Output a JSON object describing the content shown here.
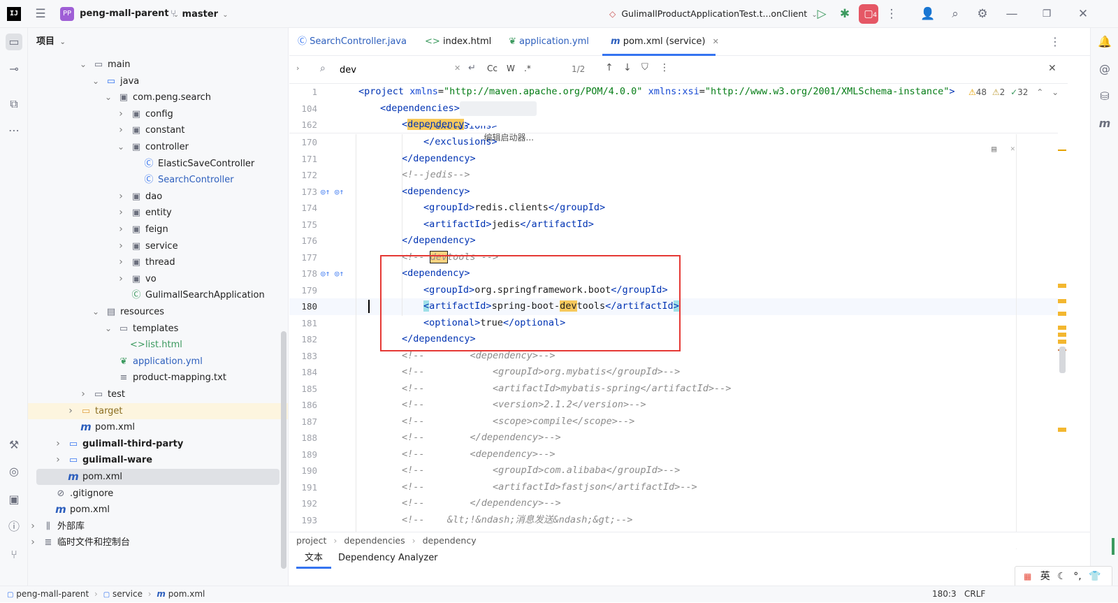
{
  "topbar": {
    "project_badge": "PP",
    "project_name": "peng-mall-parent",
    "branch": "master",
    "run_config": "GulimallProductApplicationTest.t...onClient",
    "notification_count": "4"
  },
  "project_panel": {
    "title": "项目",
    "tree": [
      {
        "label": "main",
        "depth": 0,
        "arrow": "v",
        "icon": "folder"
      },
      {
        "label": "java",
        "depth": 1,
        "arrow": "v",
        "icon": "folder-src"
      },
      {
        "label": "com.peng.search",
        "depth": 2,
        "arrow": "v",
        "icon": "package"
      },
      {
        "label": "config",
        "depth": 3,
        "arrow": ">",
        "icon": "package"
      },
      {
        "label": "constant",
        "depth": 3,
        "arrow": ">",
        "icon": "package"
      },
      {
        "label": "controller",
        "depth": 3,
        "arrow": "v",
        "icon": "package"
      },
      {
        "label": "ElasticSaveController",
        "depth": 4,
        "arrow": "",
        "icon": "class"
      },
      {
        "label": "SearchController",
        "depth": 4,
        "arrow": "",
        "icon": "class"
      },
      {
        "label": "dao",
        "depth": 3,
        "arrow": ">",
        "icon": "package"
      },
      {
        "label": "entity",
        "depth": 3,
        "arrow": ">",
        "icon": "package"
      },
      {
        "label": "feign",
        "depth": 3,
        "arrow": ">",
        "icon": "package"
      },
      {
        "label": "service",
        "depth": 3,
        "arrow": ">",
        "icon": "package"
      },
      {
        "label": "thread",
        "depth": 3,
        "arrow": ">",
        "icon": "package"
      },
      {
        "label": "vo",
        "depth": 3,
        "arrow": ">",
        "icon": "package"
      },
      {
        "label": "GulimallSearchApplication",
        "depth": 3,
        "arrow": "",
        "icon": "spring-class"
      },
      {
        "label": "resources",
        "depth": 1,
        "arrow": "v",
        "icon": "folder-res"
      },
      {
        "label": "templates",
        "depth": 2,
        "arrow": "v",
        "icon": "folder"
      },
      {
        "label": "list.html",
        "depth": 3,
        "arrow": "",
        "icon": "html"
      },
      {
        "label": "application.yml",
        "depth": 2,
        "arrow": "",
        "icon": "yml"
      },
      {
        "label": "product-mapping.txt",
        "depth": 2,
        "arrow": "",
        "icon": "txt"
      },
      {
        "label": "test",
        "depth": 0,
        "arrow": ">",
        "icon": "folder"
      },
      {
        "label": "target",
        "depth": -1,
        "arrow": ">",
        "icon": "folder-excluded"
      },
      {
        "label": "pom.xml",
        "depth": -1,
        "arrow": "",
        "icon": "maven"
      },
      {
        "label": "gulimall-third-party",
        "depth": -2,
        "arrow": ">",
        "icon": "module"
      },
      {
        "label": "gulimall-ware",
        "depth": -2,
        "arrow": ">",
        "icon": "module"
      },
      {
        "label": "pom.xml",
        "depth": -2,
        "arrow": "",
        "icon": "maven"
      },
      {
        "label": ".gitignore",
        "depth": -3,
        "arrow": "",
        "icon": "ignore"
      },
      {
        "label": "pom.xml",
        "depth": -3,
        "arrow": "",
        "icon": "maven"
      },
      {
        "label": "外部库",
        "depth": -4,
        "arrow": ">",
        "icon": "library"
      },
      {
        "label": "临时文件和控制台",
        "depth": -4,
        "arrow": ">",
        "icon": "scratch"
      }
    ]
  },
  "tabs": [
    {
      "label": "SearchController.java",
      "icon": "class"
    },
    {
      "label": "index.html",
      "icon": "html"
    },
    {
      "label": "application.yml",
      "icon": "yml"
    },
    {
      "label": "pom.xml (service)",
      "icon": "maven",
      "active": true
    }
  ],
  "search": {
    "query": "dev",
    "match_count": "1/2",
    "case_label": "Cc",
    "word_label": "W",
    "regex_label": ".*"
  },
  "inspections": {
    "warnings": "48",
    "weak_warnings": "2",
    "typos": "32"
  },
  "sticky_hint": "编辑启动器...",
  "code_lines": [
    {
      "n": "1"
    },
    {
      "n": "104"
    },
    {
      "n": "162"
    },
    {
      "n": "170"
    },
    {
      "n": "171"
    },
    {
      "n": "172"
    },
    {
      "n": "173"
    },
    {
      "n": "174"
    },
    {
      "n": "175"
    },
    {
      "n": "176"
    },
    {
      "n": "177"
    },
    {
      "n": "178"
    },
    {
      "n": "179"
    },
    {
      "n": "180"
    },
    {
      "n": "181"
    },
    {
      "n": "182"
    },
    {
      "n": "183"
    },
    {
      "n": "184"
    },
    {
      "n": "185"
    },
    {
      "n": "186"
    },
    {
      "n": "187"
    },
    {
      "n": "188"
    },
    {
      "n": "189"
    },
    {
      "n": "190"
    },
    {
      "n": "191"
    },
    {
      "n": "192"
    },
    {
      "n": "193"
    }
  ],
  "code_text": {
    "l1_tag": "project",
    "l1_a1": "xmlns",
    "l1_v1": "\"http://maven.apache.org/POM/4.0.0\"",
    "l1_a2": "xmlns:xsi",
    "l1_v2": "\"http://www.w3.org/2001/XMLSchema-instance\"",
    "dependencies": "dependencies",
    "dependency": "dependency",
    "exclusions": "exclusions",
    "jedis_comment": "<!--jedis-->",
    "groupId": "groupId",
    "artifactId": "artifactId",
    "optional": "optional",
    "redis_group": "redis.clients",
    "jedis": "jedis",
    "devtools_comment_pre": "<!-- ",
    "devtools_comment_dev": "dev",
    "devtools_comment_post": "tools -->",
    "spring_group": "org.springframework.boot",
    "sb_pre": "spring-boot-",
    "sb_dev": "dev",
    "sb_post": "tools",
    "true": "true",
    "c183": "<!--        <dependency>-->",
    "c184": "<!--            <groupId>org.mybatis</groupId>-->",
    "c185": "<!--            <artifactId>mybatis-spring</artifactId>-->",
    "c186": "<!--            <version>2.1.2</version>-->",
    "c187": "<!--            <scope>compile</scope>-->",
    "c188": "<!--        </dependency>-->",
    "c189": "<!--        <dependency>-->",
    "c190": "<!--            <groupId>com.alibaba</groupId>-->",
    "c191": "<!--            <artifactId>fastjson</artifactId>-->",
    "c192": "<!--        </dependency>-->",
    "c193": "<!--    &lt;!&ndash;消息发送&ndash;&gt;-->"
  },
  "breadcrumb": [
    "project",
    "dependencies",
    "dependency"
  ],
  "bottom_tabs": [
    {
      "label": "文本",
      "active": true
    },
    {
      "label": "Dependency Analyzer"
    }
  ],
  "statusbar": {
    "path": [
      "peng-mall-parent",
      "service",
      "pom.xml"
    ],
    "position": "180:3",
    "line_sep": "CRLF"
  },
  "ime": {
    "lang": "英"
  },
  "colors": {
    "accent": "#3574f0",
    "highlight_box": "#e53935",
    "match": "#f7c95c"
  }
}
